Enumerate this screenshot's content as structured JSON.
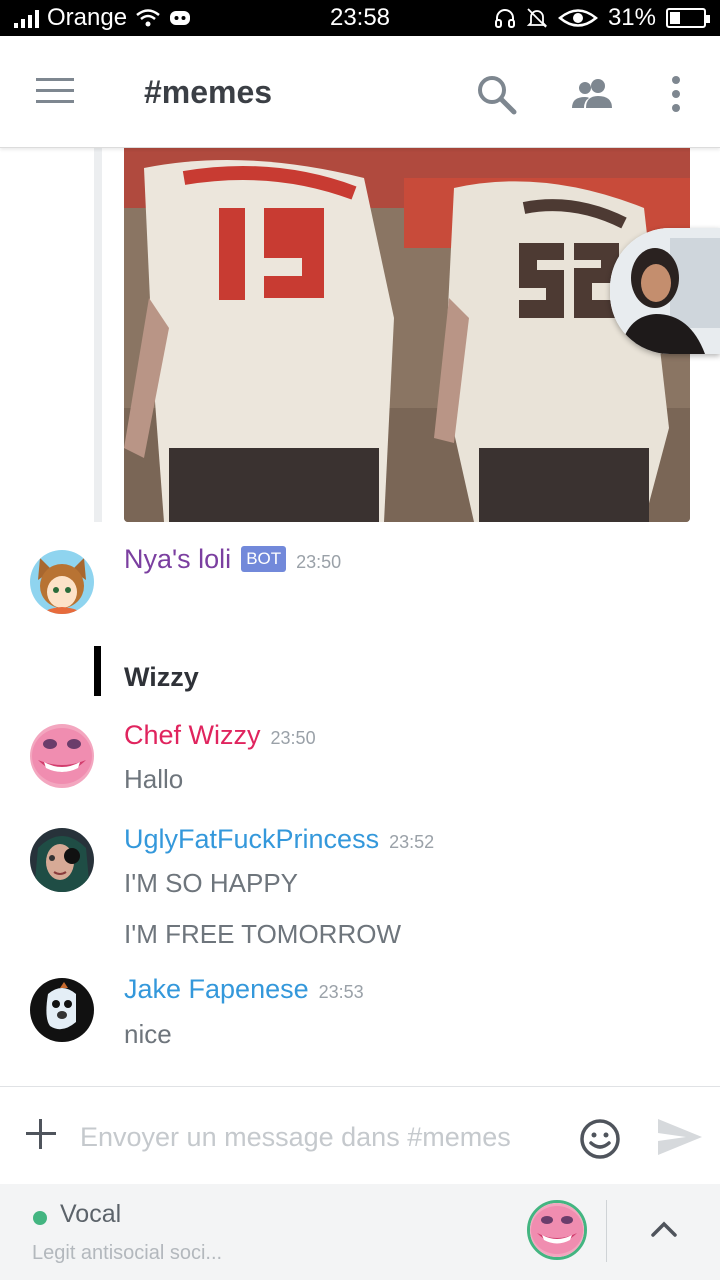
{
  "status_bar": {
    "carrier": "Orange",
    "time": "23:58",
    "battery": "31%",
    "battery_level": 0.31,
    "icons": [
      "signal-icon",
      "wifi-icon",
      "discord-icon",
      "headphones-icon",
      "bell-off-icon",
      "eye-icon",
      "battery-icon"
    ]
  },
  "header": {
    "title": "#memes",
    "icons": [
      "menu-icon",
      "search-icon",
      "members-icon",
      "more-icon"
    ]
  },
  "messages": [
    {
      "author": "Nya's loli",
      "badge": "BOT",
      "time": "23:50",
      "color": "#7b3fa0"
    },
    {
      "quote": "Wizzy"
    },
    {
      "author": "Chef Wizzy",
      "time": "23:50",
      "color": "#e0245e",
      "lines": [
        "Hallo"
      ]
    },
    {
      "author": "UglyFatFuckPrincess",
      "time": "23:52",
      "color": "#3498db",
      "lines": [
        "I'M SO HAPPY",
        "I'M FREE TOMORROW"
      ]
    },
    {
      "author": "Jake Fapenese",
      "time": "23:53",
      "color": "#3498db",
      "lines": [
        "nice"
      ]
    }
  ],
  "composer": {
    "placeholder": "Envoyer un message dans #memes",
    "icons": [
      "plus-icon",
      "emoji-icon",
      "send-icon"
    ]
  },
  "voice": {
    "label": "Vocal",
    "channel": "Legit antisocial soci...",
    "status_color": "#43b581",
    "icons": [
      "chevron-up-icon"
    ]
  },
  "colors": {
    "blurple": "#7289da",
    "online": "#43b581"
  }
}
